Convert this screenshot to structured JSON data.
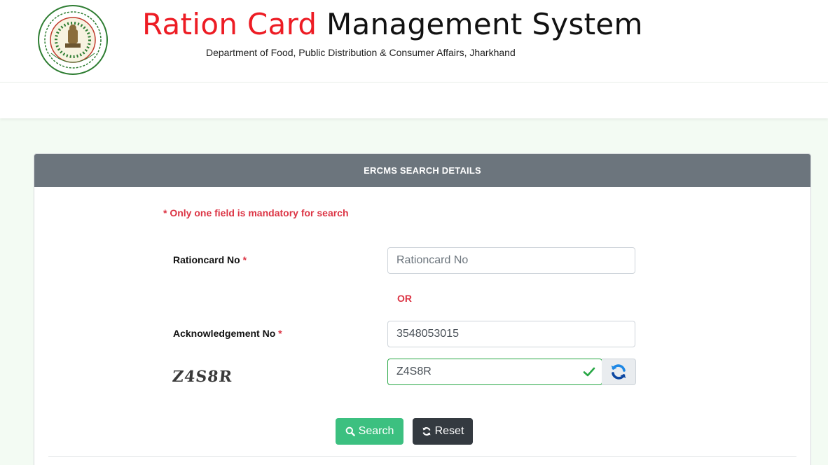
{
  "header": {
    "title_part1": "Ration Card",
    "title_part2": "Management System",
    "subtitle": "Department of Food, Public Distribution & Consumer Affairs, Jharkhand",
    "logo_icon": "government-of-jharkhand-seal"
  },
  "panel": {
    "heading": "ERCMS SEARCH DETAILS",
    "mandatory_note": "* Only one field is mandatory for search",
    "rationcard": {
      "label": "Rationcard No",
      "star": "*",
      "placeholder": "Rationcard No",
      "value": ""
    },
    "or_text": "OR",
    "acknowledgement": {
      "label": "Acknowledgement No",
      "star": "*",
      "value": "3548053015"
    },
    "captcha": {
      "image_text": "Z4S8R",
      "input_value": "Z4S8R",
      "status": "valid",
      "refresh_icon": "refresh-icon"
    },
    "buttons": {
      "search_label": "Search",
      "reset_label": "Reset"
    }
  },
  "colors": {
    "title_red": "#ed1c24",
    "panel_header": "#6c757d",
    "search_button": "#3cc080",
    "reset_button": "#343a40",
    "required_red": "#dc3545",
    "valid_green": "#28a745"
  }
}
